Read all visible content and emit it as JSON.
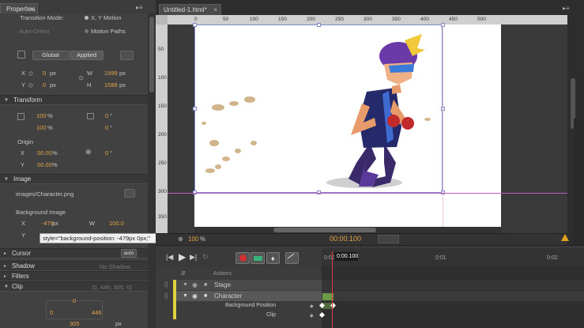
{
  "properties_panel": {
    "tab_label": "Properties",
    "transition_mode_label": "Transition Mode:",
    "transition_mode_value": "X, Y Motion",
    "auto_orient_label": "Auto-Orient",
    "motion_paths_label": "Motion Paths",
    "global_label": "Global",
    "applied_label": "Applied",
    "x_label": "X",
    "x_value": "0",
    "x_unit": "px",
    "y_label": "Y",
    "y_value": "0",
    "y_unit": "px",
    "w_label": "W",
    "w_value": "1999",
    "w_unit": "px",
    "h_label": "H",
    "h_value": "1588",
    "h_unit": "px",
    "transform_section": "Transform",
    "scale_x_value": "100",
    "scale_x_unit": "%",
    "scale_y_value": "100",
    "scale_y_unit": "%",
    "skew_x_value": "0",
    "skew_x_unit": "°",
    "skew_y_value": "0",
    "skew_y_unit": "°",
    "origin_label": "Origin",
    "origin_x_label": "X",
    "origin_x_value": "50.00",
    "origin_x_unit": "%",
    "origin_y_label": "Y",
    "origin_y_value": "50.00",
    "origin_y_unit": "%",
    "rotate_value": "0",
    "rotate_unit": "°",
    "image_section": "Image",
    "image_path": "images/Character.png",
    "background_image_label": "Background Image",
    "bg_x_label": "X",
    "bg_x_value": "-479",
    "bg_x_unit": "px",
    "bg_w_label": "W",
    "bg_w_value": "100.0",
    "bg_y_label": "Y",
    "tooltip_text": "style=\"background-position: -479px 0px;\"",
    "cursor_section": "Cursor",
    "cursor_value": "auto",
    "shadow_section": "Shadow",
    "shadow_value": "No Shadow",
    "filters_section": "Filters",
    "clip_section": "Clip",
    "clip_value": "(0, 446, 305, 0)",
    "clip_top": "0",
    "clip_left": "0",
    "clip_right": "446",
    "clip_bottom": "305",
    "clip_unit": "px"
  },
  "document": {
    "tab_label": "Untitled-1.html*",
    "ruler_h_ticks": [
      "0",
      "50",
      "100",
      "150",
      "200",
      "250",
      "300",
      "350",
      "400",
      "450",
      "500"
    ],
    "ruler_v_ticks": [
      "50",
      "100",
      "150",
      "200",
      "250",
      "300",
      "350"
    ],
    "zoom_value": "100",
    "zoom_unit": "%",
    "current_time": "00:00.100"
  },
  "timeline": {
    "playhead_time": "0:00.100",
    "ruler_labels": [
      "0:00",
      "0:01",
      "0:02"
    ],
    "actions_label": "Actions",
    "rows": [
      {
        "label": "Stage"
      },
      {
        "label": "Character"
      },
      {
        "label": "Background Position"
      },
      {
        "label": "Clip"
      }
    ]
  },
  "colors": {
    "accent_orange": "#e3a247",
    "playhead_red": "#e03a3a",
    "selection_blue": "#7f8ac8",
    "guide_magenta": "#c05cc0"
  }
}
